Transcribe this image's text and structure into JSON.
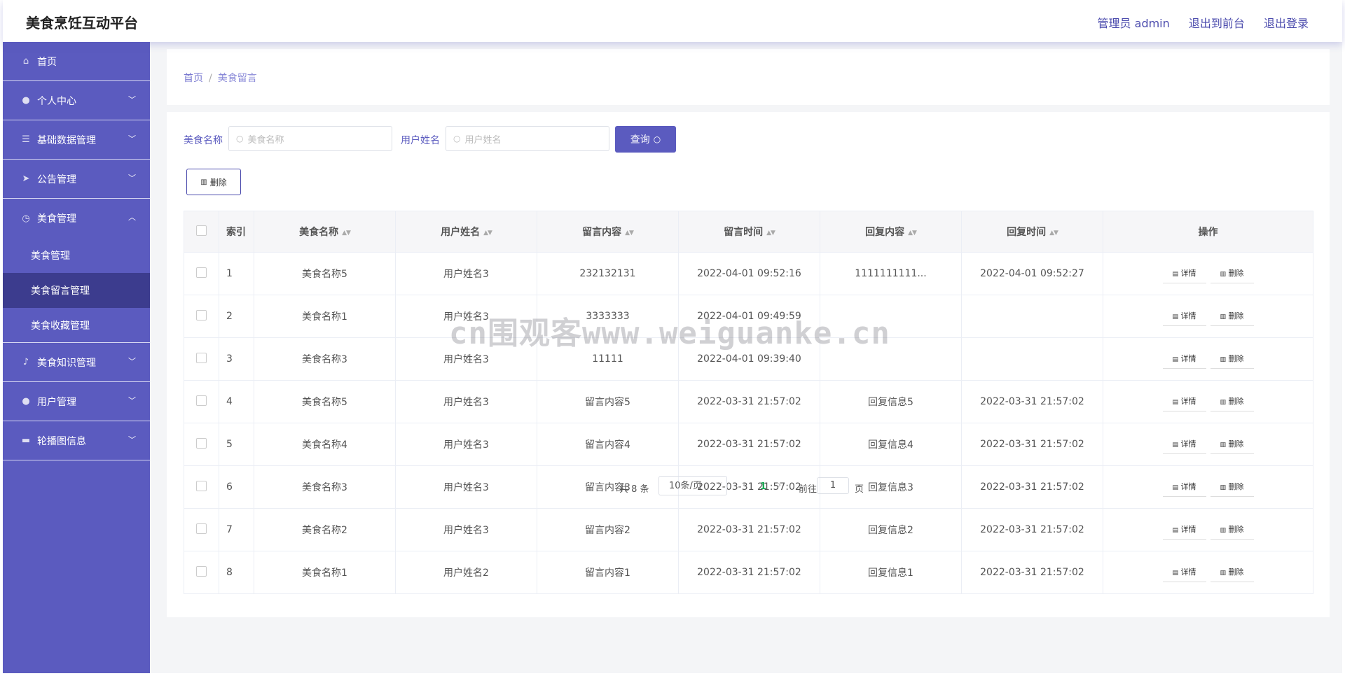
{
  "header": {
    "brand": "美食烹饪互动平台",
    "admin": "管理员 admin",
    "to_front": "退出到前台",
    "logout": "退出登录"
  },
  "sidebar": {
    "items": [
      {
        "label": "首页",
        "icon": "home-icon"
      },
      {
        "label": "个人中心",
        "icon": "user-icon"
      },
      {
        "label": "基础数据管理",
        "icon": "list-icon"
      },
      {
        "label": "公告管理",
        "icon": "send-icon"
      },
      {
        "label": "美食管理",
        "icon": "clock-icon"
      },
      {
        "label": "美食知识管理",
        "icon": "mic-icon"
      },
      {
        "label": "用户管理",
        "icon": "user-icon"
      },
      {
        "label": "轮播图信息",
        "icon": "image-icon"
      }
    ],
    "sub_items": [
      "美食管理",
      "美食留言管理",
      "美食收藏管理"
    ]
  },
  "breadcrumb": {
    "home": "首页",
    "sep": "/",
    "current": "美食留言"
  },
  "search": {
    "food_label": "美食名称",
    "food_placeholder": "美食名称",
    "user_label": "用户姓名",
    "user_placeholder": "用户姓名",
    "query_button": "查询"
  },
  "delete_button": "删除",
  "table": {
    "headers": [
      "索引",
      "美食名称",
      "用户姓名",
      "留言内容",
      "留言时间",
      "回复内容",
      "回复时间",
      "操作"
    ],
    "rows": [
      [
        "1",
        "美食名称5",
        "用户姓名3",
        "232132131",
        "2022-04-01 09:52:16",
        "1111111111...",
        "2022-04-01 09:52:27"
      ],
      [
        "2",
        "美食名称1",
        "用户姓名3",
        "3333333",
        "2022-04-01 09:49:59",
        "",
        ""
      ],
      [
        "3",
        "美食名称3",
        "用户姓名3",
        "11111",
        "2022-04-01 09:39:40",
        "",
        ""
      ],
      [
        "4",
        "美食名称5",
        "用户姓名3",
        "留言内容5",
        "2022-03-31 21:57:02",
        "回复信息5",
        "2022-03-31 21:57:02"
      ],
      [
        "5",
        "美食名称4",
        "用户姓名3",
        "留言内容4",
        "2022-03-31 21:57:02",
        "回复信息4",
        "2022-03-31 21:57:02"
      ],
      [
        "6",
        "美食名称3",
        "用户姓名3",
        "留言内容3",
        "2022-03-31 21:57:02",
        "回复信息3",
        "2022-03-31 21:57:02"
      ],
      [
        "7",
        "美食名称2",
        "用户姓名3",
        "留言内容2",
        "2022-03-31 21:57:02",
        "回复信息2",
        "2022-03-31 21:57:02"
      ],
      [
        "8",
        "美食名称1",
        "用户姓名2",
        "留言内容1",
        "2022-03-31 21:57:02",
        "回复信息1",
        "2022-03-31 21:57:02"
      ]
    ],
    "detail_label": "详情",
    "delete_label": "删除"
  },
  "pagination": {
    "total": "共 8 条",
    "page_size": "10条/页",
    "current_page": "1",
    "goto_prefix": "前往",
    "goto_value": "1",
    "goto_suffix": "页"
  },
  "watermark": "cn围观客www.weiguanke.cn"
}
